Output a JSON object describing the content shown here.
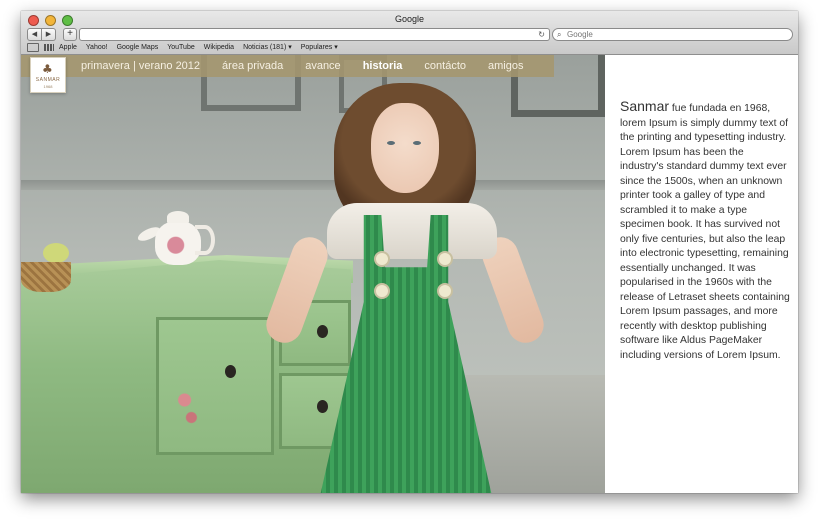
{
  "browser": {
    "window_title": "Google",
    "search_placeholder": "Google",
    "bookmarks": [
      "Apple",
      "Yahoo!",
      "Google Maps",
      "YouTube",
      "Wikipedia",
      "Noticias (181) ▾",
      "Populares ▾"
    ]
  },
  "site": {
    "logo": {
      "name": "SANMAR",
      "sub": "1968"
    },
    "menu": [
      {
        "label": "primavera | verano 2012",
        "active": false
      },
      {
        "label": "área privada",
        "active": false
      },
      {
        "label": "avance",
        "active": false
      },
      {
        "label": "historia",
        "active": true
      },
      {
        "label": "contácto",
        "active": false
      },
      {
        "label": "amigos",
        "active": false
      }
    ],
    "article": {
      "brand": "Sanmar",
      "body": " fue fundada en 1968, lorem Ipsum is simply dummy text of the printing and typesetting industry. Lorem Ipsum has been the industry's standard dummy text ever since the 1500s, when an unknown printer took a galley of type and scrambled it to make a type specimen book. It has survived not only five centuries, but also the leap into electronic typesetting, remaining essentially unchanged. It was popularised in the 1960s with the release of Letraset sheets containing Lorem Ipsum passages, and more recently with desktop publishing software like Aldus PageMaker including versions of Lorem Ipsum."
    }
  },
  "colors": {
    "menu_bar": "#a5966e",
    "panel_bg": "#ffffff",
    "text": "#333333"
  }
}
